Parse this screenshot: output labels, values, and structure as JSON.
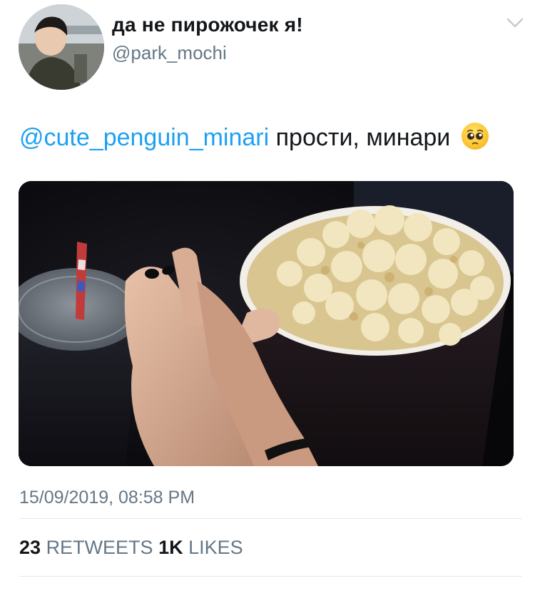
{
  "user": {
    "display_name": "да не пирожочек я!",
    "handle": "@park_mochi"
  },
  "tweet": {
    "mention": "@cute_penguin_minari",
    "text": "прости, минари",
    "emoji": "pleading-face"
  },
  "timestamp": "15/09/2019, 08:58 PM",
  "stats": {
    "retweets_count": "23",
    "retweets_label": "RETWEETS",
    "likes_count": "1K",
    "likes_label": "LIKES"
  },
  "colors": {
    "link": "#1da1f2",
    "secondary": "#657786",
    "primary": "#14171a",
    "divider": "#e1e8ed"
  }
}
